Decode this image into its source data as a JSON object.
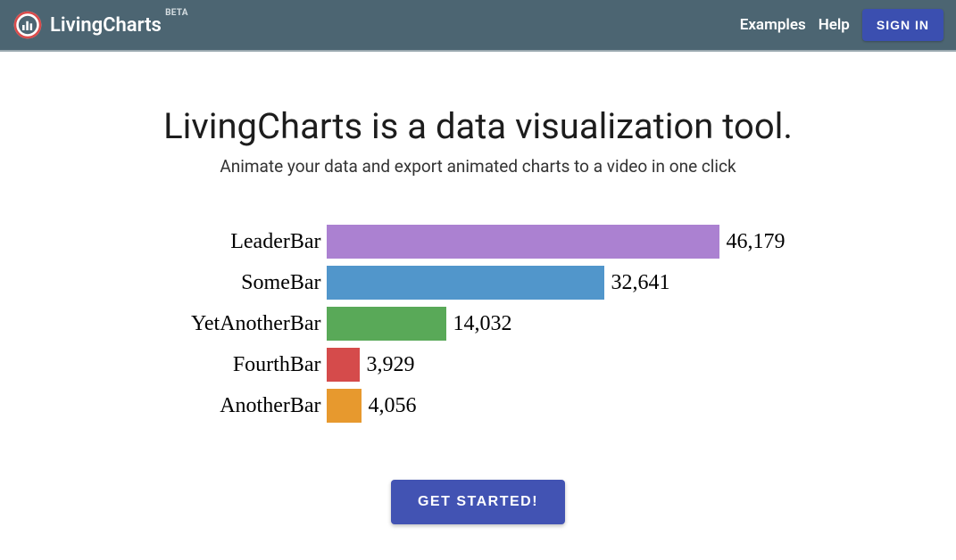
{
  "brand": {
    "name": "LivingCharts",
    "badge": "BETA"
  },
  "nav": {
    "examples": "Examples",
    "help": "Help",
    "signin": "SIGN IN"
  },
  "hero": {
    "title": "LivingCharts is a data visualization tool.",
    "subtitle": "Animate your data and export animated charts to a video in one click"
  },
  "chart_data": {
    "type": "bar",
    "orientation": "horizontal",
    "title": "",
    "xlabel": "",
    "ylabel": "",
    "categories": [
      "LeaderBar",
      "SomeBar",
      "YetAnotherBar",
      "FourthBar",
      "AnotherBar"
    ],
    "values": [
      46179,
      32641,
      14032,
      3929,
      4056
    ],
    "value_labels": [
      "46,179",
      "32,641",
      "14,032",
      "3,929",
      "4,056"
    ],
    "colors": [
      "#ab81d1",
      "#5196cb",
      "#59a958",
      "#d54b4b",
      "#e7992e"
    ]
  },
  "cta": {
    "label": "GET STARTED!"
  }
}
